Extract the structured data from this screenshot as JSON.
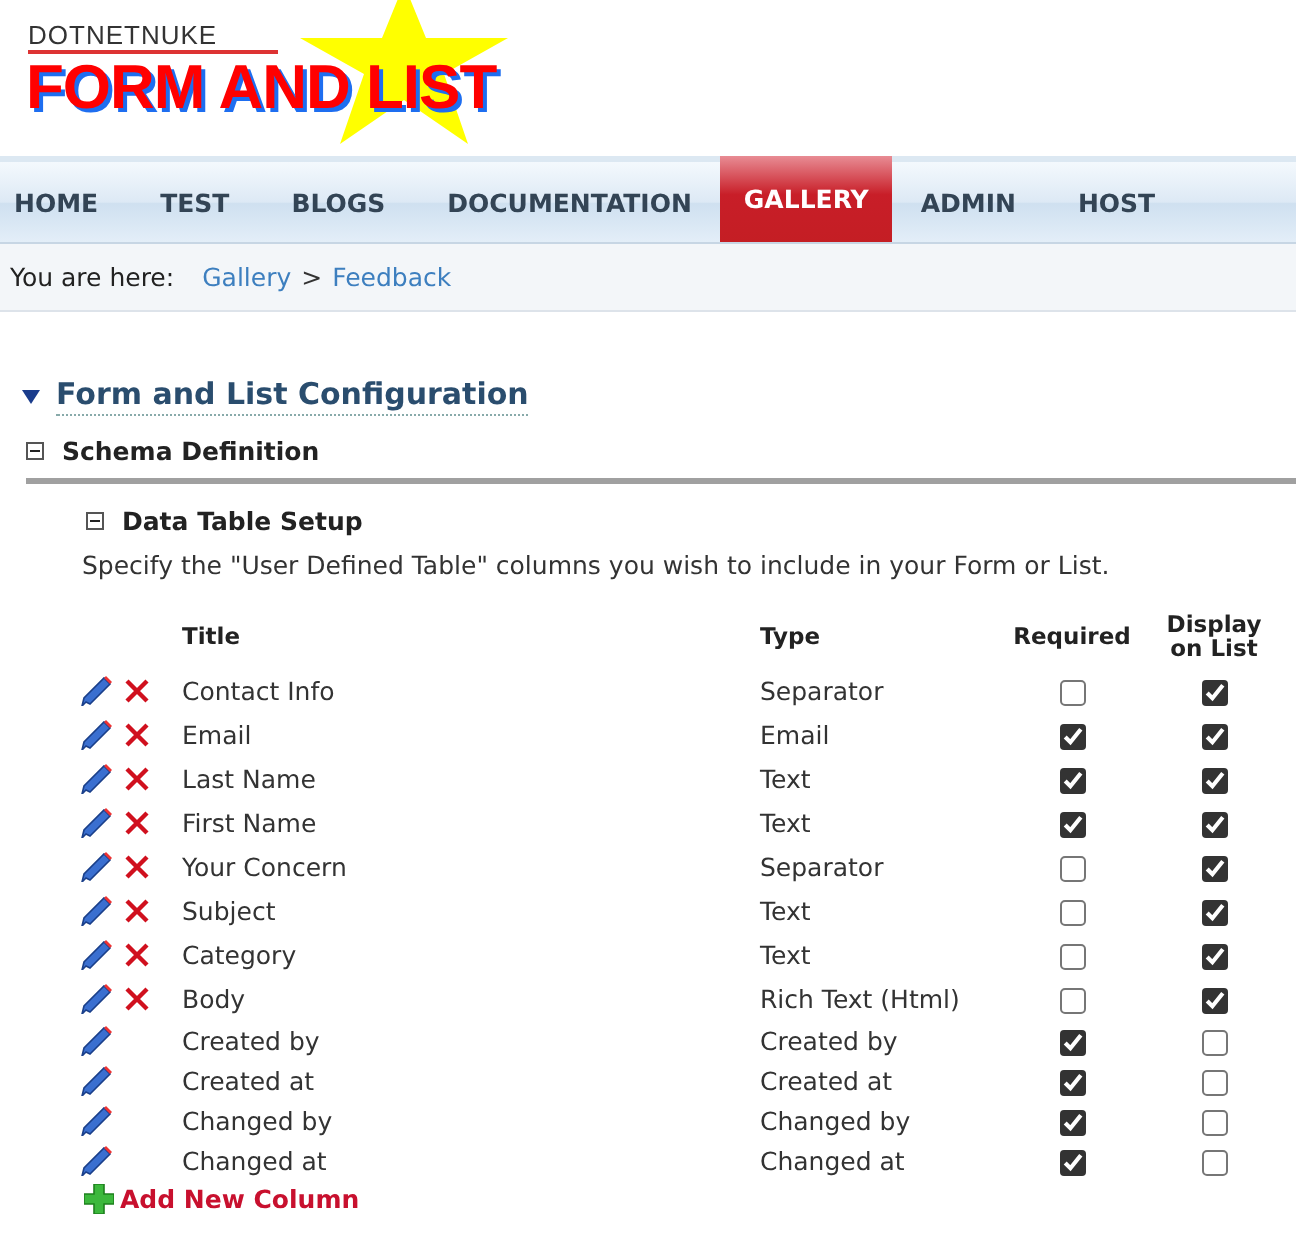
{
  "logo": {
    "brand": "DOTNETNUKE",
    "title": "FORM AND LIST"
  },
  "nav": [
    {
      "label": "HOME",
      "selected": false
    },
    {
      "label": "TEST",
      "selected": false
    },
    {
      "label": "BLOGS",
      "selected": false
    },
    {
      "label": "DOCUMENTATION",
      "selected": false
    },
    {
      "label": "GALLERY",
      "selected": true
    },
    {
      "label": "ADMIN",
      "selected": false
    },
    {
      "label": "HOST",
      "selected": false
    }
  ],
  "breadcrumb": {
    "label": "You are here:",
    "items": [
      "Gallery",
      "Feedback"
    ],
    "separator": ">"
  },
  "module_title": "Form and List Configuration",
  "section": {
    "title": "Schema Definition",
    "expanded": true
  },
  "subsection": {
    "title": "Data Table Setup",
    "expanded": true
  },
  "description": "Specify the \"User Defined Table\" columns you wish to include in your Form or List.",
  "table": {
    "columns": [
      "Title",
      "Type",
      "Required",
      "Display on List"
    ],
    "rows": [
      {
        "title": "Contact Info",
        "type": "Separator",
        "deletable": true,
        "required": false,
        "display_on_list": true
      },
      {
        "title": "Email",
        "type": "Email",
        "deletable": true,
        "required": true,
        "display_on_list": true
      },
      {
        "title": "Last Name",
        "type": "Text",
        "deletable": true,
        "required": true,
        "display_on_list": true
      },
      {
        "title": "First Name",
        "type": "Text",
        "deletable": true,
        "required": true,
        "display_on_list": true
      },
      {
        "title": "Your Concern",
        "type": "Separator",
        "deletable": true,
        "required": false,
        "display_on_list": true
      },
      {
        "title": "Subject",
        "type": "Text",
        "deletable": true,
        "required": false,
        "display_on_list": true
      },
      {
        "title": "Category",
        "type": "Text",
        "deletable": true,
        "required": false,
        "display_on_list": true
      },
      {
        "title": "Body",
        "type": "Rich Text (Html)",
        "deletable": true,
        "required": false,
        "display_on_list": true
      },
      {
        "title": "Created by",
        "type": "Created by",
        "deletable": false,
        "required": true,
        "display_on_list": false
      },
      {
        "title": "Created at",
        "type": "Created at",
        "deletable": false,
        "required": true,
        "display_on_list": false
      },
      {
        "title": "Changed by",
        "type": "Changed by",
        "deletable": false,
        "required": true,
        "display_on_list": false
      },
      {
        "title": "Changed at",
        "type": "Changed at",
        "deletable": false,
        "required": true,
        "display_on_list": false
      }
    ]
  },
  "add_link": "Add New Column"
}
